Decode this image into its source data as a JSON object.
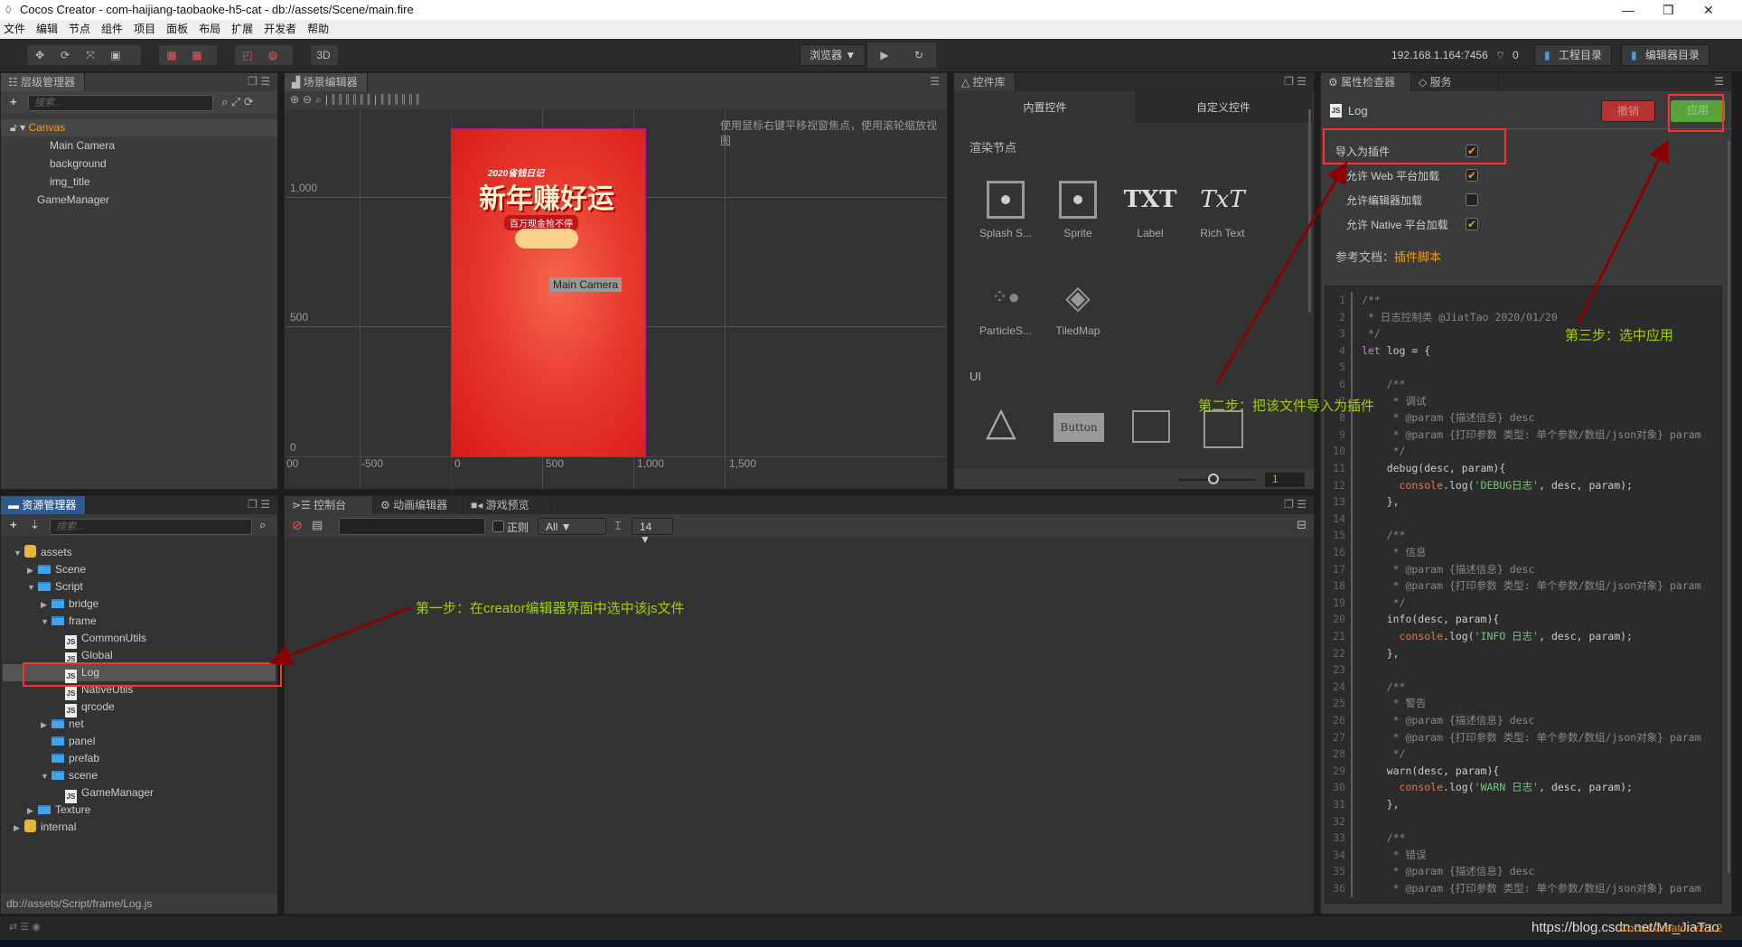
{
  "window": {
    "title": "Cocos Creator - com-haijiang-taobaoke-h5-cat - db://assets/Scene/main.fire",
    "controls": [
      "—",
      "❐",
      "✕"
    ]
  },
  "menu": [
    "文件",
    "编辑",
    "节点",
    "组件",
    "项目",
    "面板",
    "布局",
    "扩展",
    "开发者",
    "帮助"
  ],
  "toolbar": {
    "mode_3d": "3D",
    "browser": "浏览器 ▼",
    "ip": "192.168.1.164:7456",
    "wifi_count": "0",
    "project_dir": "工程目录",
    "editor_dir": "编辑器目录"
  },
  "hierarchy": {
    "title": "层级管理器",
    "search_placeholder": "搜索...",
    "nodes": [
      {
        "label": "Canvas",
        "depth": 0,
        "expanded": true,
        "root": true
      },
      {
        "label": "Main Camera",
        "depth": 1
      },
      {
        "label": "background",
        "depth": 1
      },
      {
        "label": "img_title",
        "depth": 1
      },
      {
        "label": "GameManager",
        "depth": 0
      }
    ]
  },
  "scene": {
    "title": "场景编辑器",
    "hint": "使用鼠标右键平移视窗焦点，使用滚轮缩放视图",
    "y_ticks": [
      "1,000",
      "500",
      "0"
    ],
    "x_ticks": [
      "00",
      "-500",
      "0",
      "500",
      "1,000",
      "1,500"
    ],
    "camera_label": "Main Camera",
    "banner_date": "2020省钱日记",
    "banner_title": "新年赚好运",
    "banner_sub": "百万现金抢不停"
  },
  "library": {
    "title": "控件库",
    "tabs": [
      "内置控件",
      "自定义控件"
    ],
    "section_render": "渲染节点",
    "section_ui": "UI",
    "render_items": [
      "Splash S...",
      "Sprite",
      "Label",
      "Rich Text",
      "ParticleS...",
      "TiledMap"
    ],
    "ui_button_text": "Button",
    "zoom_value": "1"
  },
  "assets": {
    "title": "资源管理器",
    "search_placeholder": "搜索...",
    "path": "db://assets/Script/frame/Log.js",
    "tree": [
      {
        "label": "assets",
        "depth": 0,
        "type": "db",
        "arrow": "down"
      },
      {
        "label": "Scene",
        "depth": 1,
        "type": "folder",
        "arrow": "right"
      },
      {
        "label": "Script",
        "depth": 1,
        "type": "folder",
        "arrow": "down"
      },
      {
        "label": "bridge",
        "depth": 2,
        "type": "folder",
        "arrow": "right"
      },
      {
        "label": "frame",
        "depth": 2,
        "type": "folder",
        "arrow": "down"
      },
      {
        "label": "CommonUtils",
        "depth": 3,
        "type": "js"
      },
      {
        "label": "Global",
        "depth": 3,
        "type": "js"
      },
      {
        "label": "Log",
        "depth": 3,
        "type": "js",
        "selected": true
      },
      {
        "label": "NativeUtils",
        "depth": 3,
        "type": "js"
      },
      {
        "label": "qrcode",
        "depth": 3,
        "type": "js"
      },
      {
        "label": "net",
        "depth": 2,
        "type": "folder",
        "arrow": "right"
      },
      {
        "label": "panel",
        "depth": 2,
        "type": "folder"
      },
      {
        "label": "prefab",
        "depth": 2,
        "type": "folder"
      },
      {
        "label": "scene",
        "depth": 2,
        "type": "folder",
        "arrow": "down"
      },
      {
        "label": "GameManager",
        "depth": 3,
        "type": "js"
      },
      {
        "label": "Texture",
        "depth": 1,
        "type": "folder",
        "arrow": "right"
      },
      {
        "label": "internal",
        "depth": 0,
        "type": "db",
        "arrow": "right"
      }
    ]
  },
  "console": {
    "tabs": [
      "控制台",
      "动画编辑器",
      "游戏预览"
    ],
    "regex_label": "正则",
    "level": "All ▼",
    "font_size": "14 ▼"
  },
  "inspector": {
    "tabs": [
      "属性检查器",
      "服务"
    ],
    "asset_name": "Log",
    "revert": "撤销",
    "apply": "应用",
    "props": [
      {
        "label": "导入为插件",
        "checked": true
      },
      {
        "label": "允许 Web 平台加载",
        "checked": true
      },
      {
        "label": "允许编辑器加载",
        "checked": false
      },
      {
        "label": "允许 Native 平台加载",
        "checked": true
      }
    ],
    "doc_label": "参考文档：",
    "doc_link": "插件脚本",
    "code": [
      "/**",
      " * 日志控制类 @JiatTao 2020/01/20",
      " */",
      "let log = {",
      "",
      "    /**",
      "     * 调试",
      "     * @param {描述信息} desc",
      "     * @param {打印参数 类型: 单个参数/数组/json对象} param",
      "     */",
      "    debug(desc, param){",
      "      console.log('DEBUG日志', desc, param);",
      "    },",
      "",
      "    /**",
      "     * 信息",
      "     * @param {描述信息} desc",
      "     * @param {打印参数 类型: 单个参数/数组/json对象} param",
      "     */",
      "    info(desc, param){",
      "      console.log('INFO 日志', desc, param);",
      "    },",
      "",
      "    /**",
      "     * 警告",
      "     * @param {描述信息} desc",
      "     * @param {打印参数 类型: 单个参数/数组/json对象} param",
      "     */",
      "    warn(desc, param){",
      "      console.log('WARN 日志', desc, param);",
      "    },",
      "",
      "    /**",
      "     * 错误",
      "     * @param {描述信息} desc",
      "     * @param {打印参数 类型: 单个参数/数组/json对象} param"
    ]
  },
  "annotations": {
    "step1": "第一步：在creator编辑器界面中选中该js文件",
    "step2": "第二步：把该文件导入为插件",
    "step3": "第三步：选中应用"
  },
  "statusbar": {
    "watermark": "https://blog.csdn.net/Mr_JiaTao",
    "version": "Cocos Creator v2.1.2"
  },
  "colors": {
    "accent_orange": "#f39c12",
    "annotation_green": "#a0d000",
    "annotation_red": "#8b0000",
    "apply_green": "#5aa33a",
    "revert_red": "#b83232"
  }
}
